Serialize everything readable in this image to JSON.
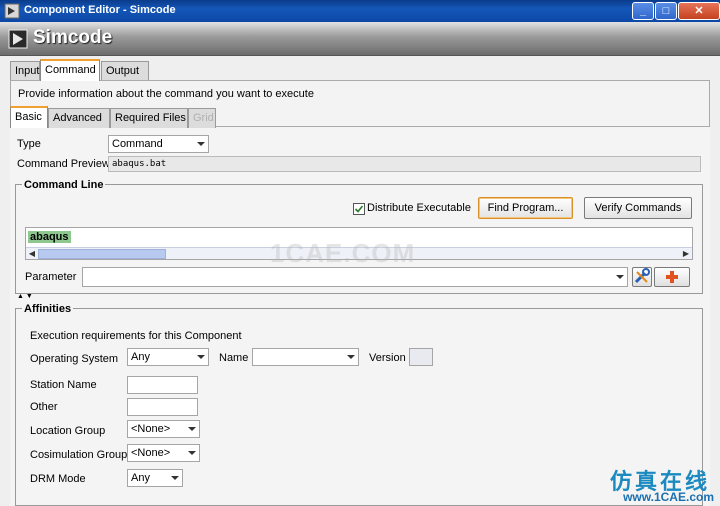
{
  "window": {
    "title": "Component Editor - Simcode",
    "controls": [
      "_",
      "□",
      "✕"
    ]
  },
  "banner": {
    "title": "Simcode"
  },
  "main_tabs": [
    {
      "label": "Input"
    },
    {
      "label": "Command"
    },
    {
      "label": "Output"
    }
  ],
  "description": "Provide information about the command you want to execute",
  "sub_tabs": [
    {
      "label": "Basic"
    },
    {
      "label": "Advanced"
    },
    {
      "label": "Required Files"
    },
    {
      "label": "Grid"
    }
  ],
  "type": {
    "label": "Type",
    "value": "Command"
  },
  "preview": {
    "label": "Command Preview",
    "value": "abaqus.bat"
  },
  "command_line": {
    "title": "Command Line",
    "distribute_label": "Distribute Executable",
    "distribute_checked": true,
    "find_button": "Find Program...",
    "verify_button": "Verify Commands",
    "text": "abaqus",
    "scroll_left": "◀",
    "scroll_right": "▶",
    "parameter_label": "Parameter",
    "parameter_value": ""
  },
  "affinities": {
    "title": "Affinities",
    "heading": "Execution requirements for this Component",
    "os_label": "Operating System",
    "os_value": "Any",
    "name_label": "Name",
    "name_value": "",
    "version_label": "Version",
    "version_value": "",
    "station_label": "Station Name",
    "other_label": "Other",
    "location_label": "Location Group",
    "location_value": "<None>",
    "cosim_label": "Cosimulation Group",
    "cosim_value": "<None>",
    "drm_label": "DRM Mode",
    "drm_value": "Any"
  },
  "watermark": "1CAE.COM",
  "brand": {
    "chinese": "仿真在线",
    "url": "www.1CAE.com"
  },
  "colors": {
    "titlebar": "#1457b8",
    "highlight": "#8fc88f",
    "focus": "#d9902a"
  }
}
